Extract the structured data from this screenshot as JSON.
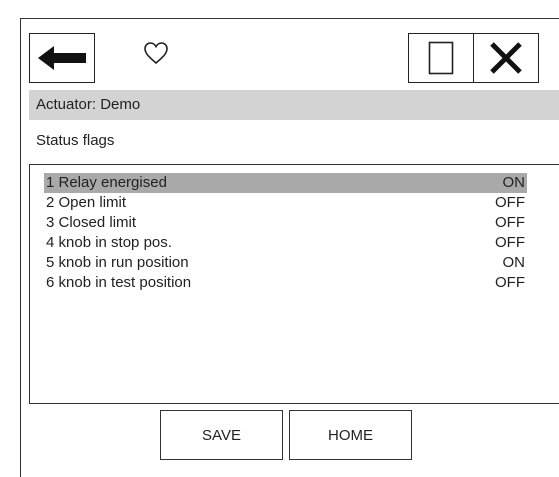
{
  "header": {
    "back_icon": "left-arrow-icon",
    "favorite_icon": "heart-outline-icon",
    "window_icon": "window-outline-icon",
    "close_icon": "close-x-icon"
  },
  "actuator": {
    "label": "Actuator: Demo"
  },
  "section": {
    "title": "Status flags"
  },
  "status_flags": {
    "selected_index": 0,
    "items": [
      {
        "label": "1 Relay energised",
        "value": "ON"
      },
      {
        "label": "2 Open limit",
        "value": "OFF"
      },
      {
        "label": "3 Closed limit",
        "value": "OFF"
      },
      {
        "label": "4 knob in stop pos.",
        "value": "OFF"
      },
      {
        "label": "5 knob in run position",
        "value": "ON"
      },
      {
        "label": "6 knob in test position",
        "value": "OFF"
      }
    ]
  },
  "footer": {
    "save_label": "SAVE",
    "home_label": "HOME"
  },
  "colors": {
    "header_bar": "#d3d3d3",
    "selected_row": "#a9a9a9",
    "border": "#333333"
  }
}
